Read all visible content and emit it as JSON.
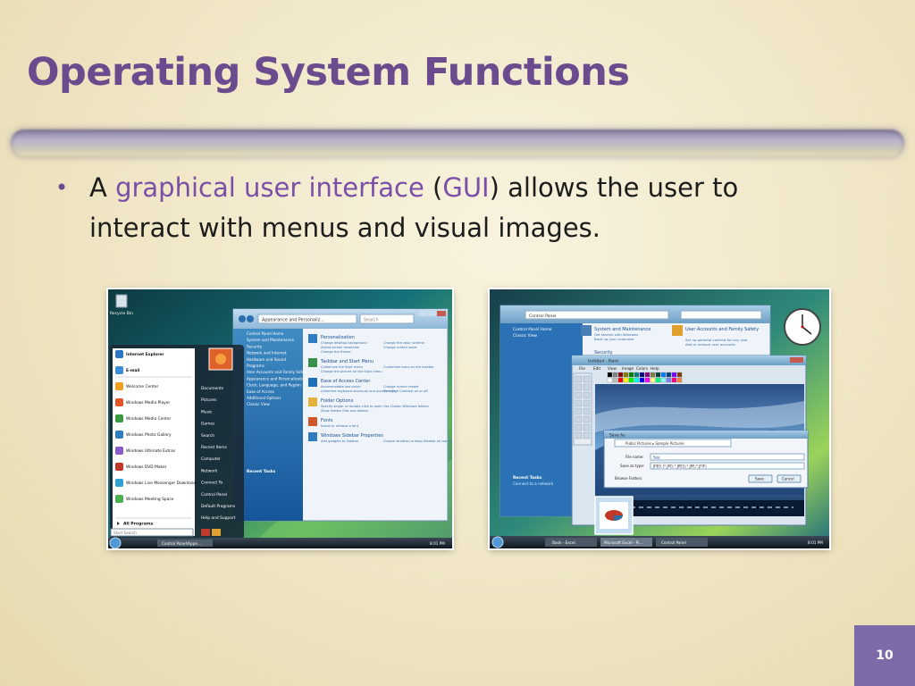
{
  "slide": {
    "title": "Operating System Functions",
    "bullet": {
      "pre": "A ",
      "term": "graphical user interface",
      "open_paren": " (",
      "abbr": "GUI",
      "post": ") allows the user to interact with menus and visual images."
    },
    "page_number": "10",
    "accent_color": "#6a4c8e",
    "highlight_color": "#7a4fa8"
  },
  "screenshot1": {
    "recycle_bin": "Recycle Bin",
    "address": "Appearance and Personaliz...",
    "search": "Search",
    "cp_nav": [
      "Control Panel Home",
      "System and Maintenance",
      "Security",
      "Network and Internet",
      "Hardware and Sound",
      "Programs",
      "User Accounts and Family Safety",
      "Appearance and Personalization",
      "Clock, Language, and Region",
      "Ease of Access",
      "Additional Options",
      "Classic View"
    ],
    "recent_tasks": "Recent Tasks",
    "cp_sections": [
      {
        "head": "Personalization",
        "links": [
          "Change desktop background",
          "Change the color scheme",
          "Adjust screen resolution",
          "Change screen saver",
          "Change the theme"
        ]
      },
      {
        "head": "Taskbar and Start Menu",
        "links": [
          "Customize the Start menu",
          "Customize icons on the taskbar",
          "Change the picture on the Start menu"
        ]
      },
      {
        "head": "Ease of Access Center",
        "links": [
          "Accommodate low vision",
          "Change screen reader",
          "Underline keyboard shortcuts and access keys",
          "Turn High Contrast on or off"
        ]
      },
      {
        "head": "Folder Options",
        "links": [
          "Specify single- or double-click to open",
          "Use Classic Windows folders",
          "Show hidden files and folders"
        ]
      },
      {
        "head": "Fonts",
        "links": [
          "Install or remove a font"
        ]
      },
      {
        "head": "Windows Sidebar Properties",
        "links": [
          "Add gadgets to Sidebar",
          "Choose whether to keep Sidebar on top of other windows"
        ]
      }
    ],
    "start_left": [
      "Internet Explorer",
      "E-mail",
      "Welcome Center",
      "Windows Media Player",
      "Windows Media Center",
      "Windows Photo Gallery",
      "Windows Ultimate Extras",
      "Windows DVD Maker",
      "Windows Live Messenger Download",
      "Windows Meeting Space"
    ],
    "all_programs": "All Programs",
    "start_search": "Start Search",
    "start_right": [
      "Documents",
      "Pictures",
      "Music",
      "Games",
      "Search",
      "Recent Items",
      "Computer",
      "Network",
      "Connect To",
      "Control Panel",
      "Default Programs",
      "Help and Support"
    ],
    "taskbar_item": "Control Panel\\Appe...",
    "clock": "8:01 PM"
  },
  "screenshot2": {
    "cp_address": "Control Panel",
    "cp_nav": [
      "Control Panel Home",
      "Classic View"
    ],
    "cp_recent": [
      "Recent Tasks",
      "Connect to a network"
    ],
    "cp_items": [
      {
        "head": "System and Maintenance",
        "links": [
          "Get started with Windows",
          "Back up your computer"
        ]
      },
      {
        "head": "User Accounts and Family Safety",
        "links": [
          "Set up parental controls for any user",
          "Add or remove user accounts"
        ]
      }
    ],
    "cp_security": "Security",
    "paint_title": "Untitled - Paint",
    "paint_menu": [
      "File",
      "Edit",
      "View",
      "Image",
      "Colors",
      "Help"
    ],
    "save_title": "Save As",
    "save_path": "Public Pictures ▸ Sample Pictures",
    "file_name_label": "File name:",
    "file_name_value": "Sea",
    "save_type_label": "Save as type:",
    "save_type_value": "JPEG (*.JPG;*.JPEG;*.JPE;*.JFIF)",
    "browse_folders": "Browse Folders",
    "save_btn": "Save",
    "cancel_btn": "Cancel",
    "taskbar_items": [
      "Book - Excel",
      "Microsoft Excel - Pi...",
      "Control Panel"
    ],
    "clock": "8:01 PM"
  }
}
